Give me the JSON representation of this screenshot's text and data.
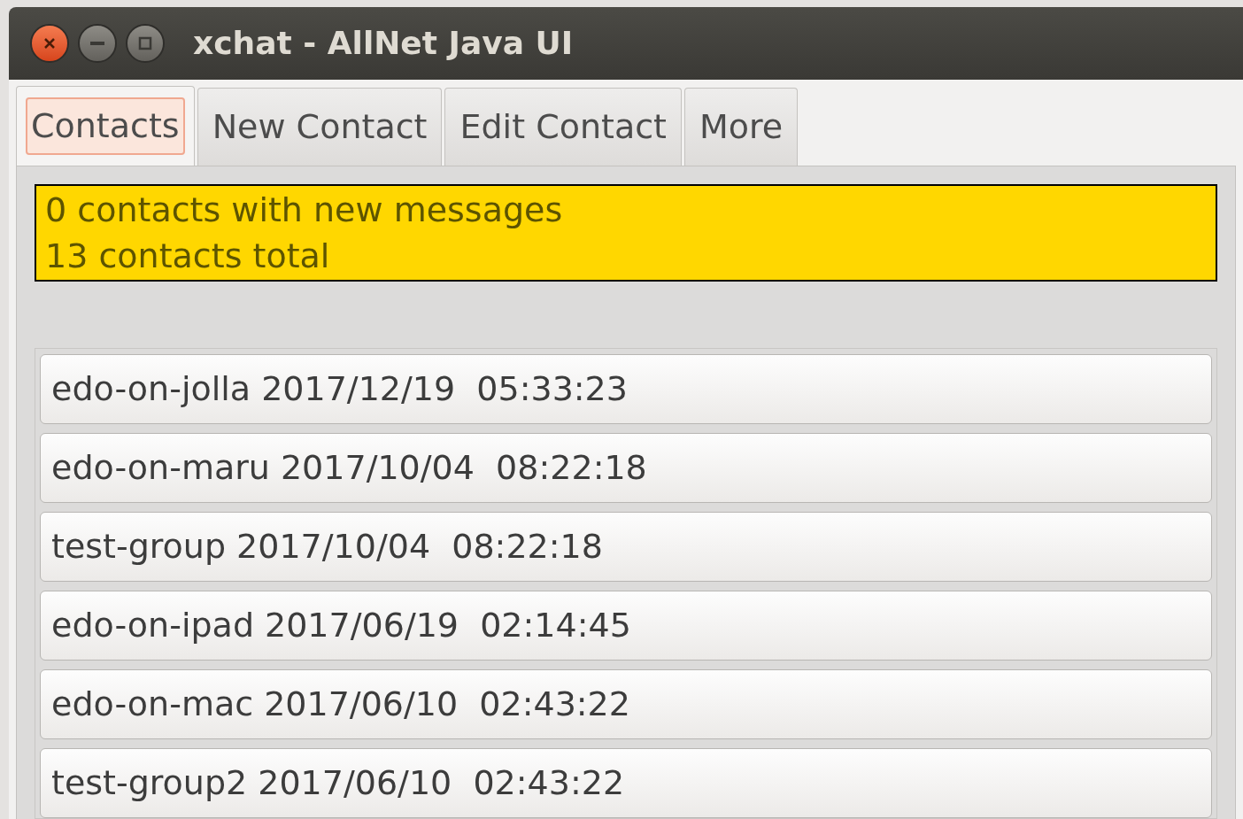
{
  "window": {
    "title": "xchat - AllNet Java UI"
  },
  "tabs": [
    {
      "label": "Contacts",
      "selected": true
    },
    {
      "label": "New Contact",
      "selected": false
    },
    {
      "label": "Edit Contact",
      "selected": false
    },
    {
      "label": "More",
      "selected": false
    }
  ],
  "summary": {
    "lines": [
      "0 contacts with new messages",
      "13 contacts total"
    ]
  },
  "contacts": [
    {
      "name": "edo-on-jolla",
      "time": "2017/12/19  05:33:23"
    },
    {
      "name": "edo-on-maru",
      "time": "2017/10/04  08:22:18"
    },
    {
      "name": "test-group",
      "time": "2017/10/04  08:22:18"
    },
    {
      "name": "edo-on-ipad",
      "time": "2017/06/19  02:14:45"
    },
    {
      "name": "edo-on-mac",
      "time": "2017/06/10  02:43:22"
    },
    {
      "name": "test-group2",
      "time": "2017/06/10  02:43:22"
    }
  ]
}
